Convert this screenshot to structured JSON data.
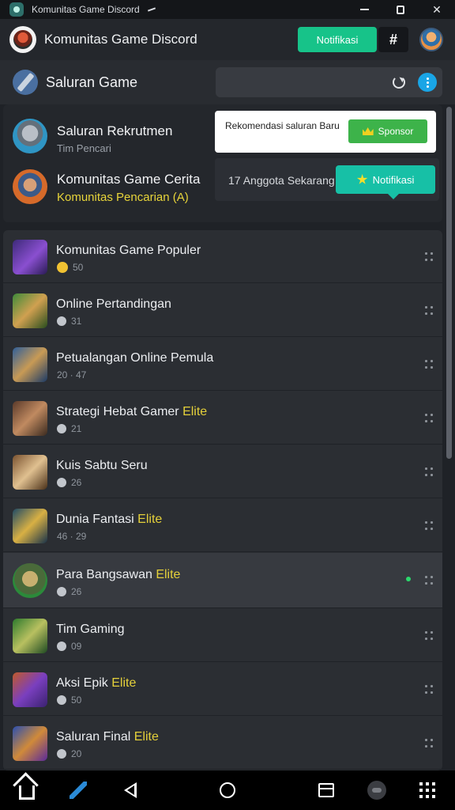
{
  "window": {
    "title": "Komunitas Game Discord"
  },
  "header": {
    "brand": "Komunitas Game Discord",
    "notify_label": "Notifikasi",
    "grid_label": "#"
  },
  "section": {
    "title": "Saluran Game"
  },
  "featured": {
    "items": [
      {
        "name": "Saluran Rekrutmen",
        "sub": "Tim Pencari"
      },
      {
        "name": "Komunitas Game Cerita",
        "sub": "Komunitas Pencarian (A)"
      }
    ],
    "popover": {
      "text": "Rekomendasi saluran Baru",
      "sponsor_label": "Sponsor"
    },
    "sub_panel_label": "17 Anggota Sekarang",
    "notif_label": "Notifikasi"
  },
  "list": {
    "items": [
      {
        "name": "Komunitas Game Populer",
        "hl": "",
        "meta": "50"
      },
      {
        "name": "Online Pertandingan",
        "hl": "",
        "meta": "31"
      },
      {
        "name": "Petualangan Online Pemula",
        "hl": "",
        "meta": "20 · 47"
      },
      {
        "name": "Strategi Hebat Gamer ",
        "hl": "Elite",
        "meta": "21"
      },
      {
        "name": "Kuis Sabtu Seru",
        "hl": "",
        "meta": "26"
      },
      {
        "name": "Dunia Fantasi ",
        "hl": "Elite",
        "meta": "46 · 29"
      },
      {
        "name": "Para Bangsawan ",
        "hl": "Elite",
        "meta": "26"
      },
      {
        "name": "Tim Gaming",
        "hl": "",
        "meta": "09"
      },
      {
        "name": "Aksi Epik ",
        "hl": "Elite",
        "meta": "50"
      },
      {
        "name": "Saluran Final ",
        "hl": "Elite",
        "meta": "20"
      }
    ]
  },
  "colors": {
    "accent_green": "#17c389",
    "accent_teal": "#17c0a6",
    "highlight_yellow": "#e4d03a",
    "sponsor_green": "#3db34a"
  }
}
